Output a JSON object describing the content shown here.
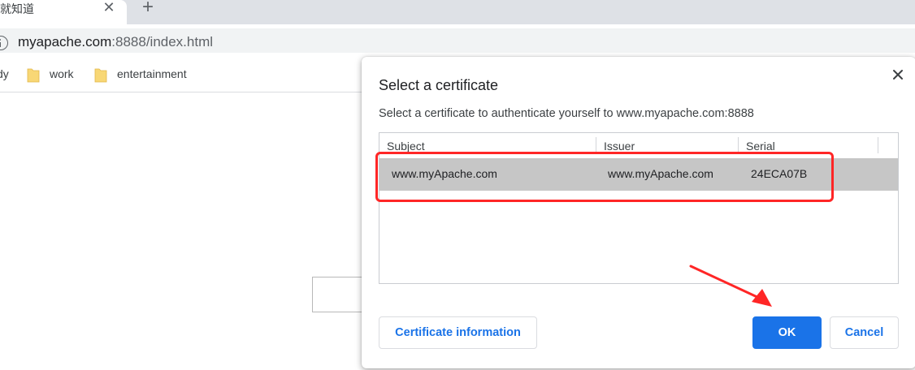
{
  "browser": {
    "tab_title": "就知道",
    "new_tab_symbol": "+",
    "close_symbol": "✕",
    "url_host": "myapache.com",
    "url_rest": ":8888/index.html",
    "bookmarks": [
      "dy",
      "work",
      "entertainment"
    ]
  },
  "dialog": {
    "title": "Select a certificate",
    "subtitle": "Select a certificate to authenticate yourself to www.myapache.com:8888",
    "columns": [
      "Subject",
      "Issuer",
      "Serial"
    ],
    "rows": [
      {
        "subject": "www.myApache.com",
        "issuer": "www.myApache.com",
        "serial": "24ECA07B",
        "selected": true
      }
    ],
    "buttons": {
      "info": "Certificate information",
      "ok": "OK",
      "cancel": "Cancel"
    }
  },
  "colors": {
    "accent": "#1a73e8",
    "annotation": "#ff2626",
    "selected_row": "#c6c6c6",
    "folder": "#f8d775"
  },
  "icons": [
    "info-icon",
    "folder-icon",
    "close-icon",
    "plus-icon"
  ]
}
